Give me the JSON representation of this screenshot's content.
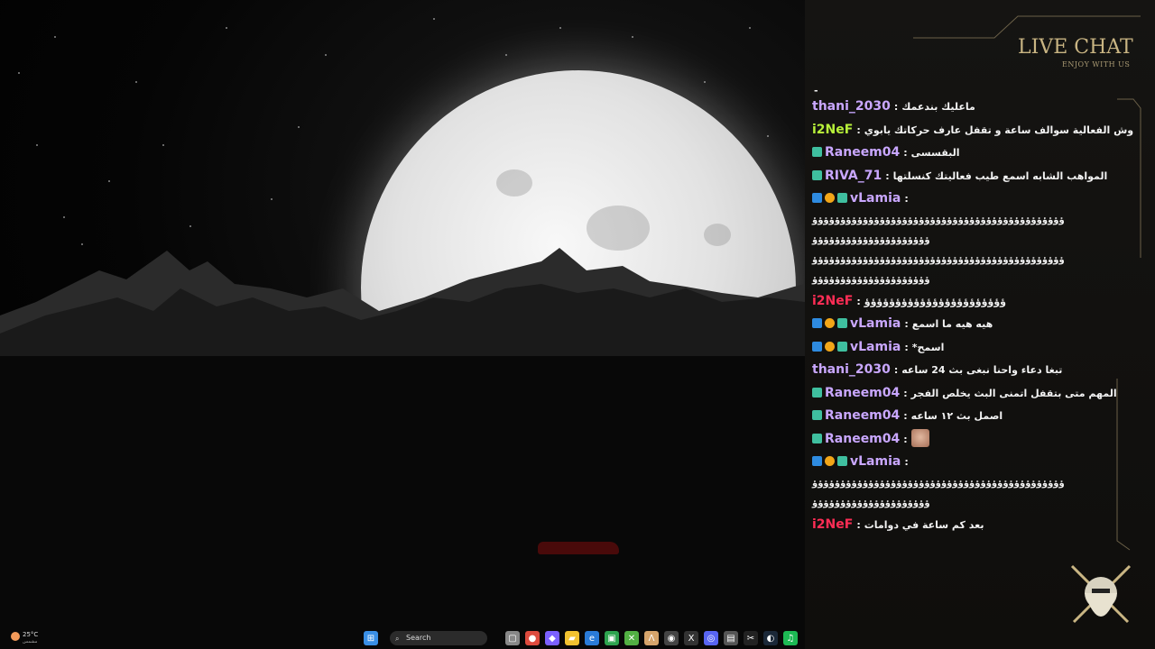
{
  "chat": {
    "title": "LIVE CHAT",
    "subtitle": "ENJOY WITH US",
    "top_fragment": "-",
    "messages": [
      {
        "user": "thani_2030",
        "color": "#c9a7ff",
        "badges": [],
        "text": "ماعليك بندعمك"
      },
      {
        "user": "i2NeF",
        "color": "#b8f23a",
        "badges": [],
        "text": "وش الفعالية سوالف ساعة و تقفل عارف حركاتك يابوي"
      },
      {
        "user": "Raneem04",
        "color": "#c9a7ff",
        "badges": [
          "sub"
        ],
        "text": "البقسسى"
      },
      {
        "user": "RIVA_71",
        "color": "#c9a7ff",
        "badges": [
          "sub"
        ],
        "text": "المواهب الشابه اسمع طيب فعاليتك كنسلتها"
      },
      {
        "user": "vLamia",
        "color": "#c9a7ff",
        "badges": [
          "arrow",
          "coin",
          "sub"
        ],
        "text": "",
        "wrap": [
          "ؤؤؤؤؤؤؤؤؤؤؤؤؤؤؤؤؤؤؤؤؤؤؤؤؤؤؤؤؤؤؤؤؤؤؤؤؤؤؤؤؤؤؤؤؤ",
          "ؤؤؤؤؤؤؤؤؤؤؤؤؤؤؤؤؤؤؤؤؤ",
          "ؤؤؤؤؤؤؤؤؤؤؤؤؤؤؤؤؤؤؤؤؤؤؤؤؤؤؤؤؤؤؤؤؤؤؤؤؤؤؤؤؤؤؤؤؤ",
          "ؤؤؤؤؤؤؤؤؤؤؤؤؤؤؤؤؤؤؤؤؤ"
        ]
      },
      {
        "user": "i2NeF",
        "color": "#ff2d55",
        "badges": [],
        "text": "ؤؤؤؤؤؤؤؤؤؤؤؤؤؤؤؤؤؤؤؤؤؤؤ"
      },
      {
        "user": "vLamia",
        "color": "#c9a7ff",
        "badges": [
          "arrow",
          "coin",
          "sub"
        ],
        "text": "هيه هيه ما اسمع"
      },
      {
        "user": "vLamia",
        "color": "#c9a7ff",
        "badges": [
          "arrow",
          "coin",
          "sub"
        ],
        "text": "اسمح*"
      },
      {
        "user": "thani_2030",
        "color": "#c9a7ff",
        "badges": [],
        "text": "تبغا دعاء واحنا نبغى بث 24 ساعه"
      },
      {
        "user": "Raneem04",
        "color": "#c9a7ff",
        "badges": [
          "sub"
        ],
        "text": "المهم متى بتقفل اتمنى البث يخلص الفجر"
      },
      {
        "user": "Raneem04",
        "color": "#c9a7ff",
        "badges": [
          "sub"
        ],
        "text": "اصمل بث ١٢ ساعه"
      },
      {
        "user": "Raneem04",
        "color": "#c9a7ff",
        "badges": [
          "sub"
        ],
        "text": "",
        "emote": "emote"
      },
      {
        "user": "vLamia",
        "color": "#c9a7ff",
        "badges": [
          "arrow",
          "coin",
          "sub"
        ],
        "text": "",
        "wrap": [
          "ؤؤؤؤؤؤؤؤؤؤؤؤؤؤؤؤؤؤؤؤؤؤؤؤؤؤؤؤؤؤؤؤؤؤؤؤؤؤؤؤؤؤؤؤؤ",
          "ؤؤؤؤؤؤؤؤؤؤؤؤؤؤؤؤؤؤؤؤؤ"
        ]
      },
      {
        "user": "i2NeF",
        "color": "#ff2d55",
        "badges": [],
        "text": "بعد كم ساعة في دوامات"
      }
    ]
  },
  "taskbar": {
    "search_placeholder": "Search",
    "weather_temp": "25°C",
    "weather_cond": "مشمس",
    "icons": [
      "windows-start-icon",
      "file-explorer-icon",
      "task-view-icon",
      "chrome-icon",
      "copilot-icon",
      "folder-icon",
      "edge-icon",
      "app-icon",
      "xbox-icon",
      "anthropic-icon",
      "app-icon-2",
      "x-icon",
      "discord-icon",
      "terminal-icon",
      "capcut-icon",
      "steam-icon",
      "spotify-icon"
    ]
  },
  "colors": {
    "accent_gold": "#c9b583",
    "panel_bg": "#12110f"
  }
}
